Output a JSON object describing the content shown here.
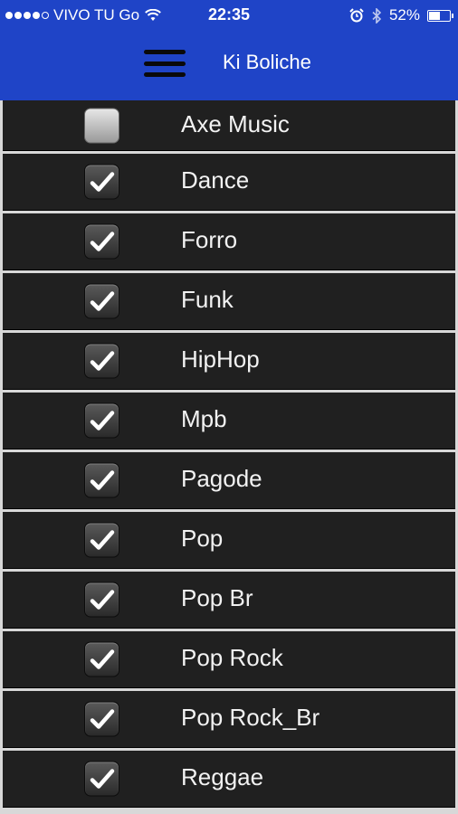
{
  "status_bar": {
    "carrier": "VIVO TU Go",
    "time": "22:35",
    "battery": "52%",
    "battery_level": 0.52,
    "icons": [
      "signal-dots-icon",
      "wifi-icon",
      "alarm-icon",
      "bluetooth-icon",
      "battery-icon"
    ]
  },
  "header": {
    "title": "Ki Boliche",
    "menu_icon": "hamburger-menu-icon",
    "background": "#1f44c7"
  },
  "genres": [
    {
      "label": "Axe Music",
      "checked": false
    },
    {
      "label": "Dance",
      "checked": true
    },
    {
      "label": "Forro",
      "checked": true
    },
    {
      "label": "Funk",
      "checked": true
    },
    {
      "label": "HipHop",
      "checked": true
    },
    {
      "label": "Mpb",
      "checked": true
    },
    {
      "label": "Pagode",
      "checked": true
    },
    {
      "label": "Pop",
      "checked": true
    },
    {
      "label": "Pop Br",
      "checked": true
    },
    {
      "label": "Pop Rock",
      "checked": true
    },
    {
      "label": "Pop Rock_Br",
      "checked": true
    },
    {
      "label": "Reggae",
      "checked": true
    }
  ]
}
